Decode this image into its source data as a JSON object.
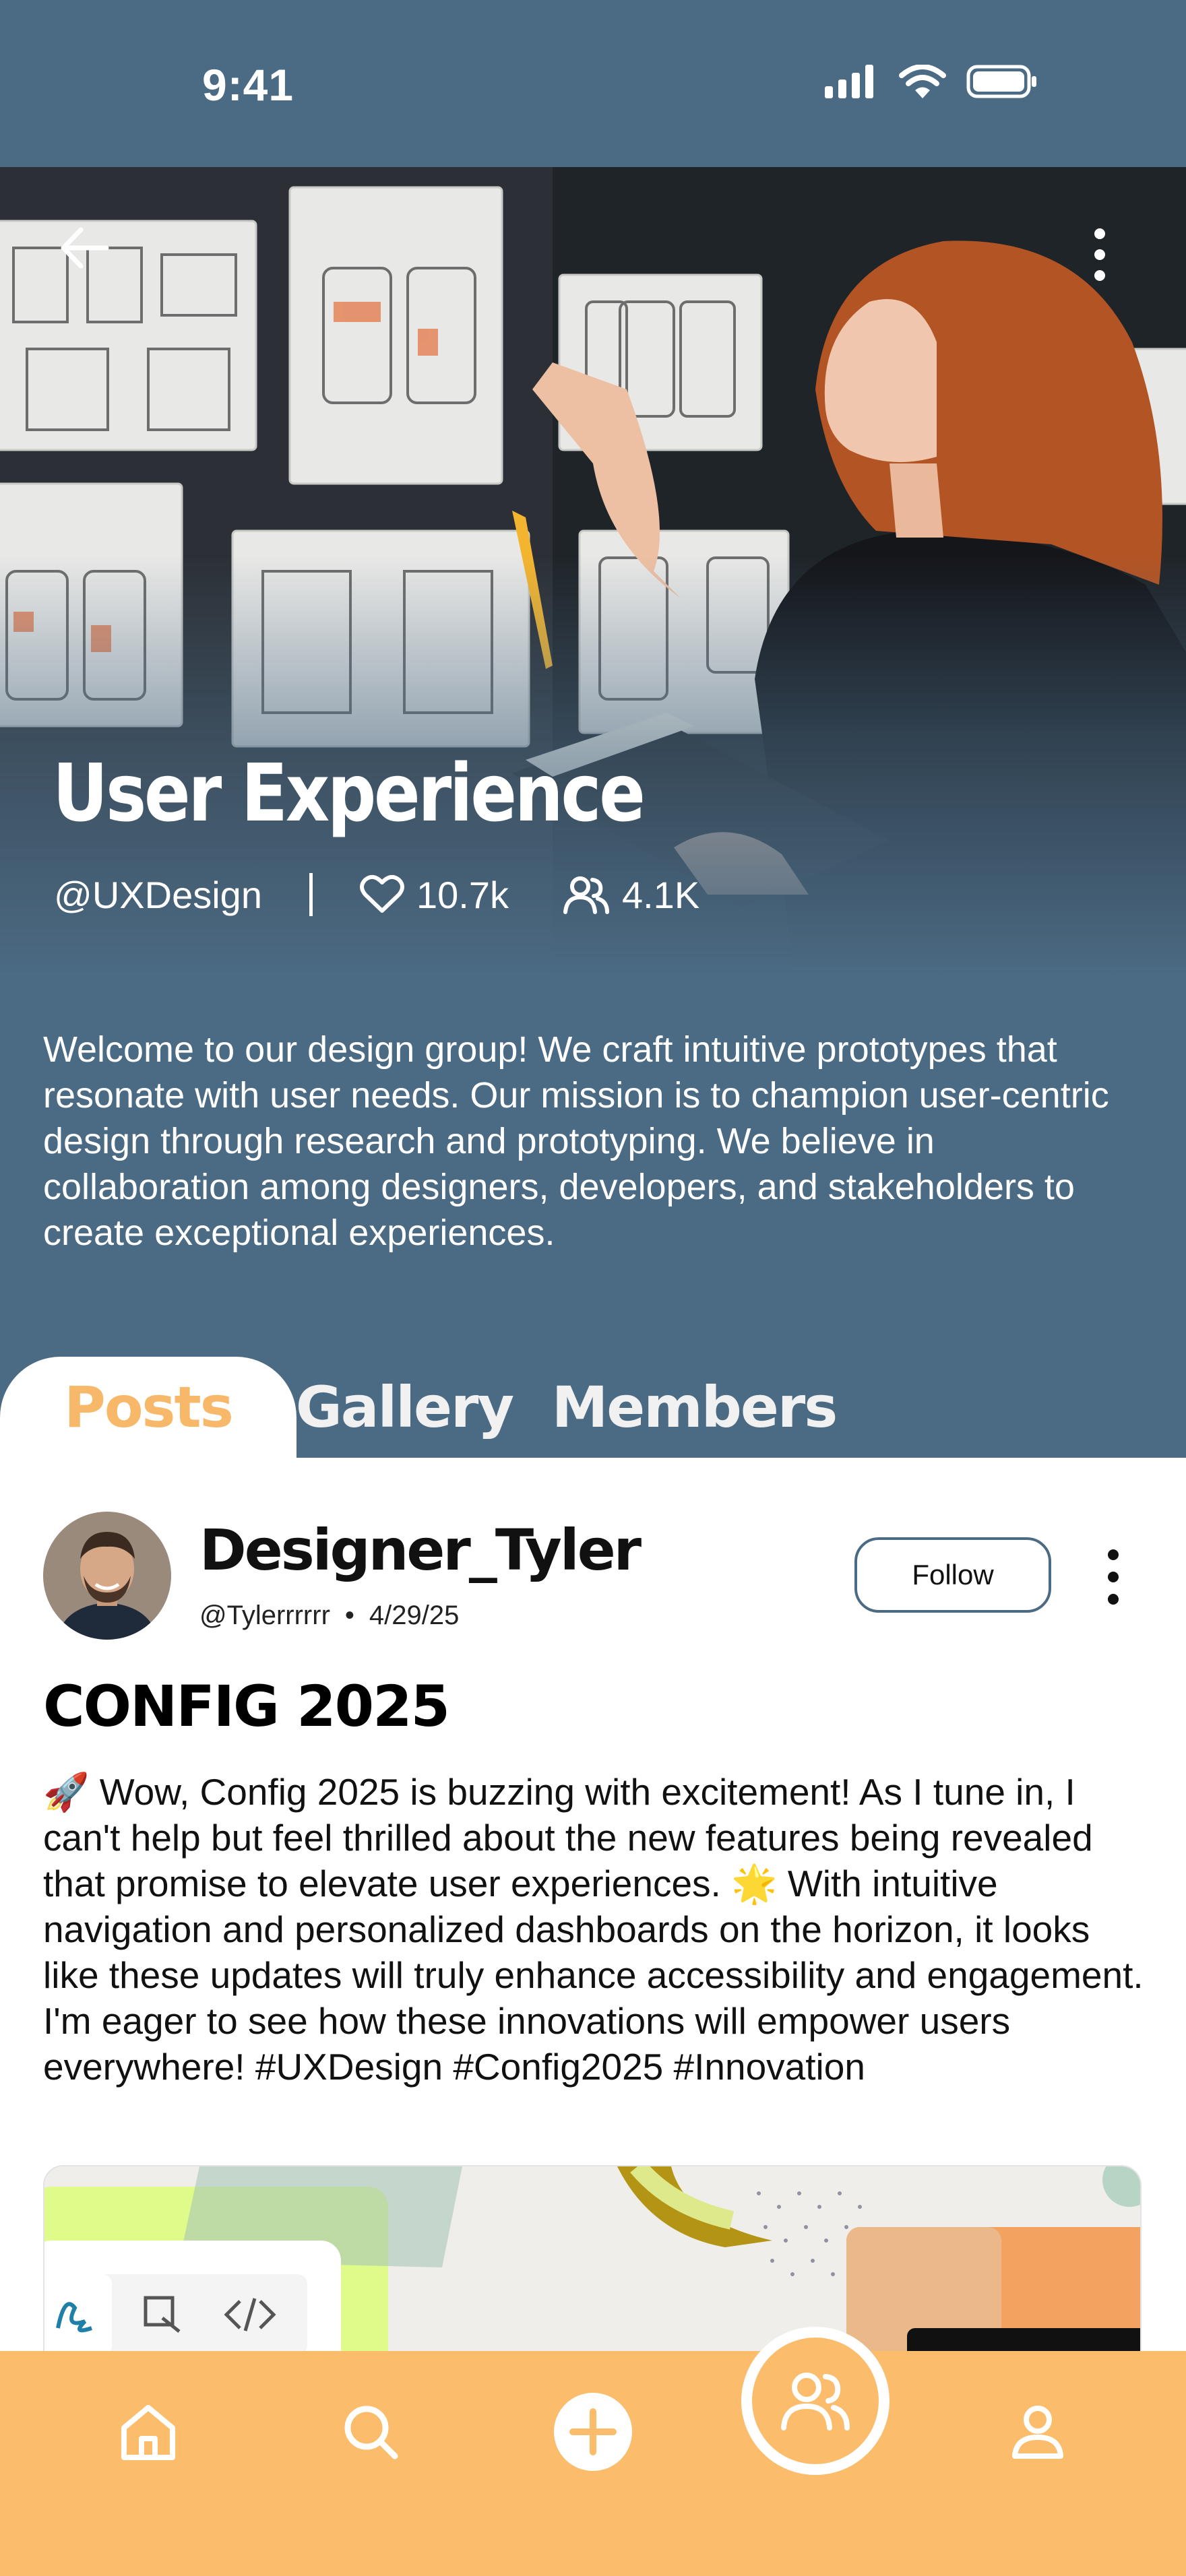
{
  "status_bar": {
    "time": "9:41"
  },
  "group": {
    "title": "User Experience",
    "handle": "@UXDesign",
    "likes": "10.7k",
    "members": "4.1K",
    "description": "Welcome to our design group! We craft intuitive prototypes that resonate with user needs. Our mission is to champion user-centric design through research and prototyping. We believe in collaboration among designers, developers, and stakeholders to create exceptional experiences."
  },
  "tabs": [
    {
      "label": "Posts",
      "active": true
    },
    {
      "label": "Gallery",
      "active": false
    },
    {
      "label": "Members",
      "active": false
    }
  ],
  "post": {
    "author_name": "Designer_Tyler",
    "author_handle": "@Tylerrrrrr",
    "date": "4/29/25",
    "follow_label": "Follow",
    "title": "CONFIG 2025",
    "body": "🚀 Wow, Config 2025 is buzzing with excitement! As I tune in, I can't help but feel thrilled about the new features being revealed that promise to elevate user experiences. 🌟 With intuitive navigation and personalized dashboards on the horizon, it looks like these updates will truly enhance accessibility and engagement. I'm eager to see how these innovations will empower users everywhere! #UXDesign #Config2025 #Innovation"
  },
  "bottom_nav": {
    "items": [
      "home-icon",
      "search-icon",
      "add-icon",
      "groups-icon",
      "profile-icon"
    ],
    "active": "groups-icon"
  },
  "colors": {
    "header_blue": "#4b6a83",
    "accent_orange": "#fbbd6c",
    "active_tab_text": "#f7b869"
  }
}
